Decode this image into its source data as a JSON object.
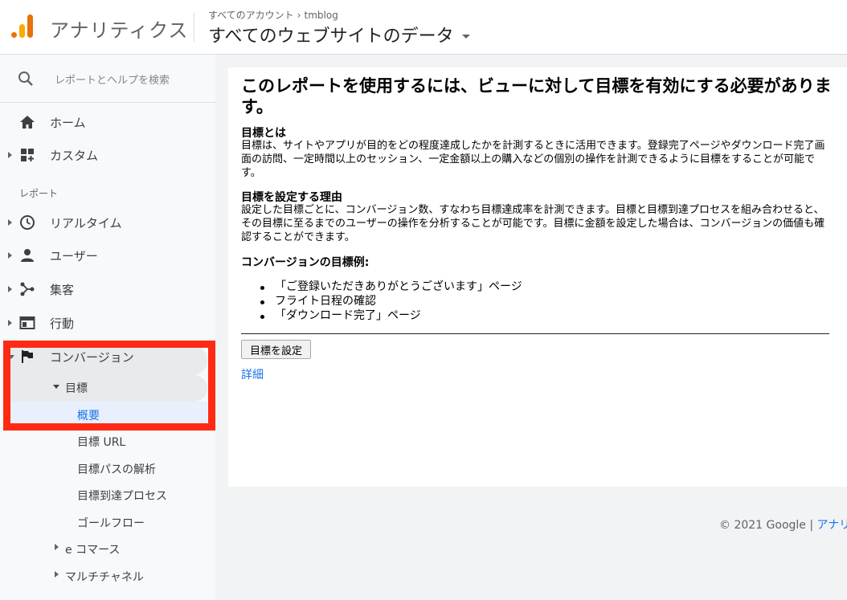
{
  "header": {
    "app_name": "アナリティクス",
    "breadcrumb_root": "すべてのアカウント",
    "breadcrumb_sep": "›",
    "breadcrumb_property": "tmblog",
    "view_name": "すべてのウェブサイトのデータ"
  },
  "sidebar": {
    "search_label": "レポートとヘルプを検索",
    "home": "ホーム",
    "custom": "カスタム",
    "reports_section": "レポート",
    "realtime": "リアルタイム",
    "audience": "ユーザー",
    "acquisition": "集客",
    "behavior": "行動",
    "conversions": "コンバージョン",
    "goals": "目標",
    "goals_overview": "概要",
    "goals_url": "目標 URL",
    "goals_reverse_path": "目標パスの解析",
    "goals_funnel": "目標到達プロセス",
    "goals_flow": "ゴールフロー",
    "ecommerce": "e コマース",
    "multichannel": "マルチチャネル"
  },
  "main": {
    "title": "このレポートを使用するには、ビューに対して目標を有効にする必要があります。",
    "what_head": "目標とは",
    "what_body": "目標は、サイトやアプリが目的をどの程度達成したかを計測するときに活用できます。登録完了ページやダウンロード完了画面の訪問、一定時間以上のセッション、一定金額以上の購入などの個別の操作を計測できるように目標をすることが可能です。",
    "why_head": "目標を設定する理由",
    "why_body": "設定した目標ごとに、コンバージョン数、すなわち目標達成率を計測できます。目標と目標到達プロセスを組み合わせると、その目標に至るまでのユーザーの操作を分析することが可能です。目標に金額を設定した場合は、コンバージョンの価値も確認することができます。",
    "examples_head": "コンバージョンの目標例:",
    "examples": [
      "「ご登録いただきありがとうございます」ページ",
      "フライト日程の確認",
      "「ダウンロード完了」ページ"
    ],
    "setup_button": "目標を設定",
    "details_link": "詳細"
  },
  "footer": {
    "copyright": "© 2021 Google | ",
    "link": "アナリ"
  },
  "colors": {
    "highlight_frame": "#ff2a14",
    "link": "#1a73e8",
    "logo_orange": "#e8710a",
    "logo_yellow": "#f9ab00"
  }
}
